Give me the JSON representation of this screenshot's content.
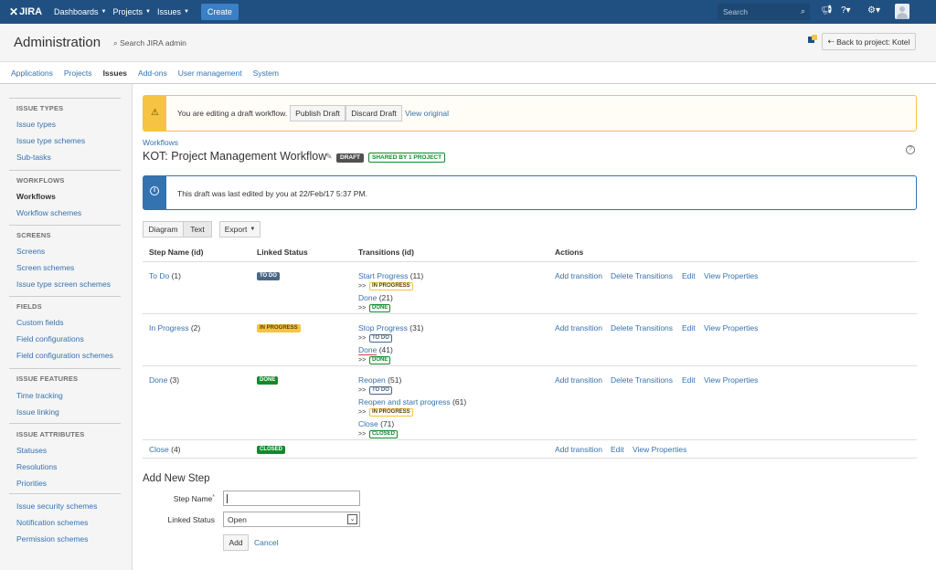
{
  "topnav": {
    "logo": "JIRA",
    "logo_mark": "✕",
    "menus": [
      "Dashboards",
      "Projects",
      "Issues"
    ],
    "create": "Create",
    "search_placeholder": "Search",
    "icons": [
      "megaphone-icon",
      "help-icon",
      "gear-icon",
      "avatar-icon"
    ]
  },
  "admin": {
    "title": "Administration",
    "search": "Search JIRA admin",
    "back": "Back to project: Kotel",
    "tabs": [
      "Applications",
      "Projects",
      "Issues",
      "Add-ons",
      "User management",
      "System"
    ],
    "active_tab": "Issues"
  },
  "sidebar": {
    "sections": [
      {
        "header": "ISSUE TYPES",
        "items": [
          "Issue types",
          "Issue type schemes",
          "Sub-tasks"
        ]
      },
      {
        "header": "WORKFLOWS",
        "items": [
          "Workflows",
          "Workflow schemes"
        ]
      },
      {
        "header": "SCREENS",
        "items": [
          "Screens",
          "Screen schemes",
          "Issue type screen schemes"
        ]
      },
      {
        "header": "FIELDS",
        "items": [
          "Custom fields",
          "Field configurations",
          "Field configuration schemes"
        ]
      },
      {
        "header": "ISSUE FEATURES",
        "items": [
          "Time tracking",
          "Issue linking"
        ]
      },
      {
        "header": "ISSUE ATTRIBUTES",
        "items": [
          "Statuses",
          "Resolutions",
          "Priorities"
        ]
      },
      {
        "header": "",
        "items": [
          "Issue security schemes",
          "Notification schemes",
          "Permission schemes"
        ]
      }
    ],
    "current": "Workflows"
  },
  "draft_banner": {
    "message": "You are editing a draft workflow.",
    "publish": "Publish Draft",
    "discard": "Discard Draft",
    "view_original": "View original"
  },
  "workflow": {
    "breadcrumb": "Workflows",
    "title": "KOT: Project Management Workflow",
    "draft_badge": "DRAFT",
    "shared_badge": "SHARED BY 1 PROJECT"
  },
  "info": {
    "message": "This draft was last edited by you at 22/Feb/17 5:37 PM."
  },
  "view": {
    "diagram": "Diagram",
    "text": "Text",
    "export": "Export"
  },
  "table": {
    "headers": [
      "Step Name (id)",
      "Linked Status",
      "Transitions (id)",
      "Actions"
    ],
    "rows": [
      {
        "step": "To Do",
        "step_id": "(1)",
        "status": "TO DO",
        "status_kind": "todo",
        "transitions": [
          {
            "name": "Start Progress",
            "id": "(11)",
            "target": "IN PROGRESS",
            "target_kind": "prog"
          },
          {
            "name": "Done",
            "id": "(21)",
            "target": "DONE",
            "target_kind": "done"
          }
        ],
        "actions": [
          "Add transition",
          "Delete Transitions",
          "Edit",
          "View Properties"
        ]
      },
      {
        "step": "In Progress",
        "step_id": "(2)",
        "status": "IN PROGRESS",
        "status_kind": "prog",
        "transitions": [
          {
            "name": "Stop Progress",
            "id": "(31)",
            "target": "TO DO",
            "target_kind": "todo"
          },
          {
            "name": "Done",
            "id": "(41)",
            "target": "DONE",
            "target_kind": "done"
          }
        ],
        "actions": [
          "Add transition",
          "Delete Transitions",
          "Edit",
          "View Properties"
        ]
      },
      {
        "step": "Done",
        "step_id": "(3)",
        "status": "DONE",
        "status_kind": "done",
        "transitions": [
          {
            "name": "Reopen",
            "id": "(51)",
            "target": "TO DO",
            "target_kind": "todo"
          },
          {
            "name": "Reopen and start progress",
            "id": "(61)",
            "target": "IN PROGRESS",
            "target_kind": "prog"
          },
          {
            "name": "Close",
            "id": "(71)",
            "target": "CLOSED",
            "target_kind": "done"
          }
        ],
        "actions": [
          "Add transition",
          "Delete Transitions",
          "Edit",
          "View Properties"
        ]
      },
      {
        "step": "Close",
        "step_id": "(4)",
        "status": "CLOSED",
        "status_kind": "done",
        "transitions": [],
        "actions": [
          "Add transition",
          "Edit",
          "View Properties"
        ]
      }
    ],
    "arrow": ">>"
  },
  "add_step": {
    "title": "Add New Step",
    "step_name_label": "Step Name",
    "required_mark": "*",
    "linked_status_label": "Linked Status",
    "linked_status_value": "Open",
    "add": "Add",
    "cancel": "Cancel"
  },
  "colors": {
    "nav": "#205081",
    "link": "#3572b0",
    "todo": "#4a6785",
    "in_progress": "#f6c342",
    "done": "#14892c"
  }
}
